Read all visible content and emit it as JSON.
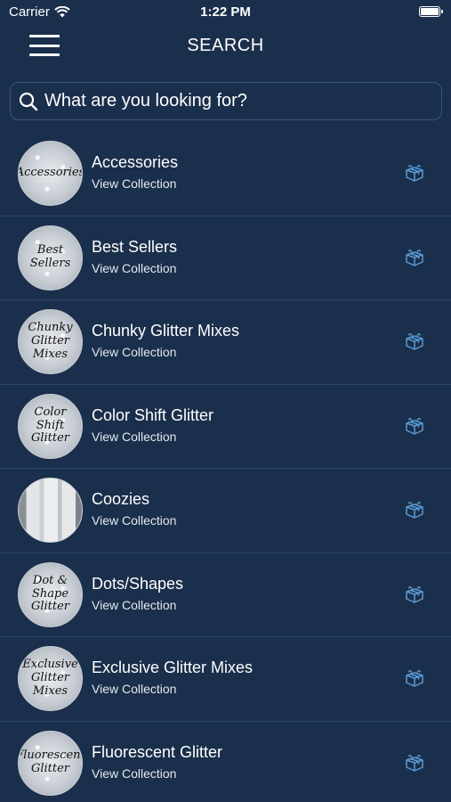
{
  "status": {
    "carrier": "Carrier",
    "time": "1:22 PM"
  },
  "header": {
    "title": "SEARCH"
  },
  "search": {
    "placeholder": "What are you looking for?"
  },
  "list": {
    "items": [
      {
        "name": "Accessories",
        "subtitle": "View Collection",
        "thumb_text": "Accessories",
        "thumb_style": "glitter"
      },
      {
        "name": "Best Sellers",
        "subtitle": "View Collection",
        "thumb_text": "Best Sellers",
        "thumb_style": "glitter"
      },
      {
        "name": "Chunky Glitter Mixes",
        "subtitle": "View Collection",
        "thumb_text": "Chunky Glitter\nMixes",
        "thumb_style": "glitter"
      },
      {
        "name": "Color Shift Glitter",
        "subtitle": "View Collection",
        "thumb_text": "Color Shift\nGlitter",
        "thumb_style": "glitter"
      },
      {
        "name": "Coozies",
        "subtitle": "View Collection",
        "thumb_text": "",
        "thumb_style": "photo"
      },
      {
        "name": "Dots/Shapes",
        "subtitle": "View Collection",
        "thumb_text": "Dot & Shape\nGlitter",
        "thumb_style": "glitter"
      },
      {
        "name": "Exclusive Glitter Mixes",
        "subtitle": "View Collection",
        "thumb_text": "Exclusive Glitter\nMixes",
        "thumb_style": "glitter"
      },
      {
        "name": "Fluorescent Glitter",
        "subtitle": "View Collection",
        "thumb_text": "Fluorescent\nGlitter",
        "thumb_style": "glitter"
      }
    ]
  },
  "colors": {
    "background": "#1a2f4b",
    "divider": "#2e4664",
    "accent_icon": "#5b9bd5"
  },
  "icons": {
    "menu": "hamburger-icon",
    "search": "search-icon",
    "row_action": "gift-box-icon"
  }
}
